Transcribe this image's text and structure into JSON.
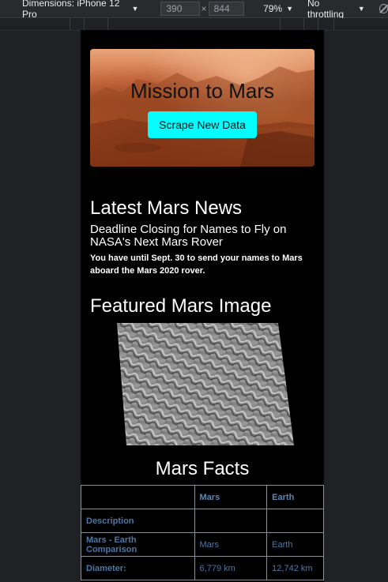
{
  "devtools": {
    "device_label": "Dimensions: iPhone 12 Pro",
    "width": "390",
    "height": "844",
    "zoom": "79%",
    "throttle": "No throttling"
  },
  "hero": {
    "title": "Mission to Mars",
    "button_label": "Scrape New Data"
  },
  "news": {
    "heading": "Latest Mars News",
    "title": "Deadline Closing for Names to Fly on NASA's Next Mars Rover",
    "paragraph": "You have until Sept. 30 to send your names to Mars aboard the Mars 2020 rover."
  },
  "featured": {
    "heading": "Featured Mars Image"
  },
  "facts": {
    "heading": "Mars Facts",
    "columns": [
      "",
      "Mars",
      "Earth"
    ],
    "rows": [
      [
        "Description",
        "",
        ""
      ],
      [
        "Mars - Earth Comparison",
        "Mars",
        "Earth"
      ],
      [
        "Diameter:",
        "6,779 km",
        "12,742 km"
      ]
    ]
  }
}
